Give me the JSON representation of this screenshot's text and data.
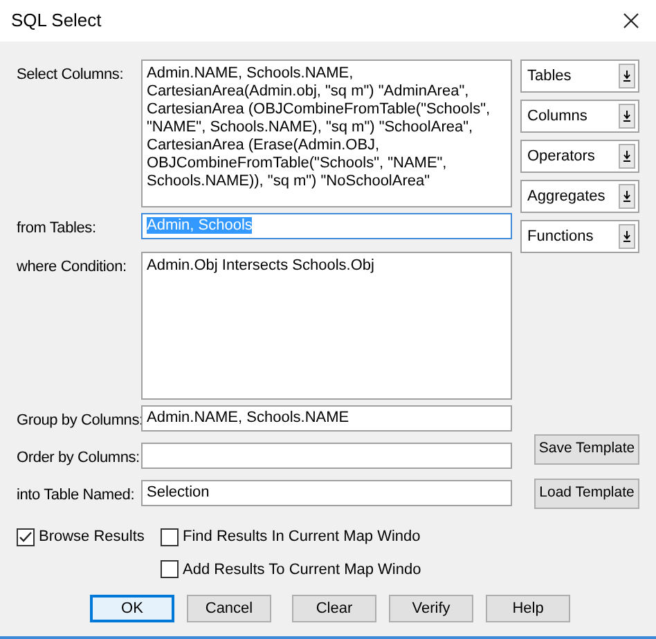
{
  "window": {
    "title": "SQL Select"
  },
  "fields": [
    {
      "label": "Select Columns:",
      "kind": "area",
      "selected": false,
      "value": "Admin.NAME, Schools.NAME, CartesianArea(Admin.obj, \"sq m\") \"AdminArea\",  CartesianArea (OBJCombineFromTable(\"Schools\", \"NAME\", Schools.NAME), \"sq m\") \"SchoolArea\", CartesianArea (Erase(Admin.OBJ, OBJCombineFromTable(\"Schools\", \"NAME\", Schools.NAME)), \"sq m\") \"NoSchoolArea\""
    },
    {
      "label": "from Tables:",
      "kind": "line",
      "selected": true,
      "value": "Admin, Schools"
    },
    {
      "label": "where Condition:",
      "kind": "area",
      "selected": false,
      "value": "Admin.Obj Intersects Schools.Obj"
    },
    {
      "label": "Group by Columns:",
      "kind": "line",
      "selected": false,
      "value": "Admin.NAME, Schools.NAME"
    },
    {
      "label": "Order by Columns:",
      "kind": "line",
      "selected": false
    },
    {
      "label": "into Table Named:",
      "kind": "line",
      "selected": false,
      "value": "Selection"
    }
  ],
  "dropdowns": [
    "Tables",
    "Columns",
    "Operators",
    "Aggregates",
    "Functions"
  ],
  "template_buttons": [
    "Save Template",
    "Load Template"
  ],
  "checkboxes": [
    {
      "label": "Browse Results",
      "checked": true
    },
    {
      "label": "Find Results In Current Map Windo",
      "checked": false
    },
    {
      "label": "Add Results To Current Map Windo",
      "checked": false
    }
  ],
  "buttons": [
    {
      "label": "OK",
      "default": true
    },
    {
      "label": "Cancel",
      "default": false
    },
    {
      "label": "Clear",
      "default": false
    },
    {
      "label": "Verify",
      "default": false
    },
    {
      "label": "Help",
      "default": false
    }
  ]
}
